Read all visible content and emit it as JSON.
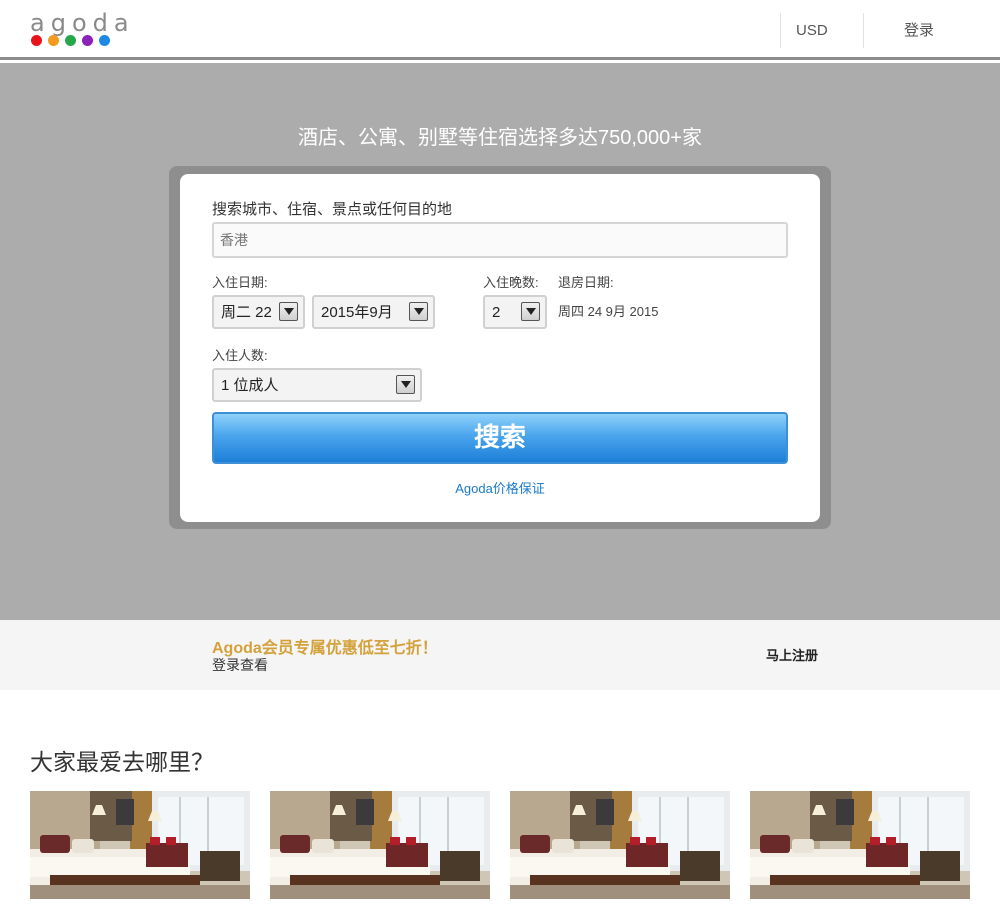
{
  "header": {
    "logo_text": "agoda",
    "logo_dot_colors": [
      "#e9141b",
      "#f49a1c",
      "#26a84a",
      "#8b21b8",
      "#1e88e5"
    ],
    "currency": "USD",
    "login": "登录"
  },
  "hero": {
    "title": "酒店、公寓、别墅等住宿选择多达750,000+家"
  },
  "search": {
    "destination_label": "搜索城市、住宿、景点或任何目的地",
    "destination_placeholder": "香港",
    "checkin_label": "入住日期:",
    "checkin_day": "周二 22",
    "checkin_month": "2015年9月",
    "nights_label": "入住晚数:",
    "nights": "2",
    "checkout_label": "退房日期:",
    "checkout_value": "周四 24 9月 2015",
    "guests_label": "入住人数:",
    "guests": "1 位成人",
    "search_button": "搜索",
    "guarantee_link": "Agoda价格保证"
  },
  "member": {
    "title": "Agoda会员专属优惠低至七折！",
    "subtitle": "登录查看",
    "signup": "马上注册"
  },
  "popular": {
    "title": "大家最爱去哪里？",
    "cards": [
      {},
      {},
      {},
      {}
    ]
  },
  "colors": {
    "hero_bg": "#acacac",
    "search_blue": "#1d7fd8",
    "member_gold": "#d4a23b",
    "link_blue": "#1a7ac9"
  }
}
